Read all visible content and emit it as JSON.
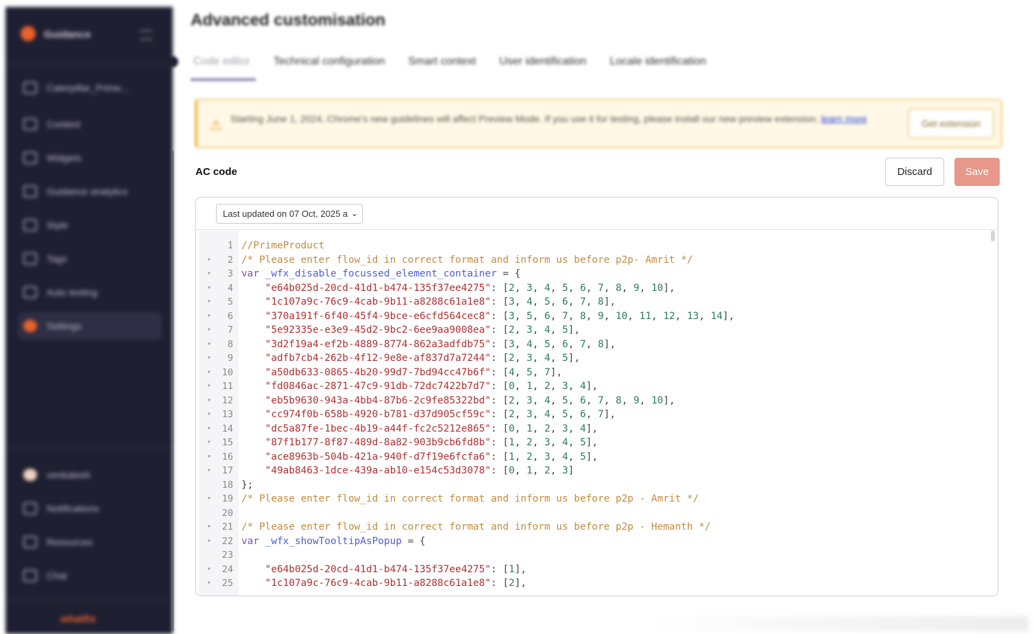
{
  "sidebar": {
    "brand": "Guidance",
    "items": [
      {
        "label": "Caterpillar_Prime...",
        "icon": "home-icon"
      },
      {
        "label": "Content",
        "icon": "grid-icon"
      },
      {
        "label": "Widgets",
        "icon": "calendar-icon"
      },
      {
        "label": "Guidance analytics",
        "icon": "analytics-icon"
      },
      {
        "label": "Style",
        "icon": "style-icon"
      },
      {
        "label": "Tags",
        "icon": "tag-icon"
      },
      {
        "label": "Auto testing",
        "icon": "test-icon"
      },
      {
        "label": "Settings",
        "icon": "settings-icon"
      }
    ],
    "footer_items": [
      {
        "label": "venkatesh",
        "icon": "avatar"
      },
      {
        "label": "Notifications",
        "icon": "bell-icon"
      },
      {
        "label": "Resources",
        "icon": "book-icon"
      },
      {
        "label": "Chat",
        "icon": "chat-icon"
      }
    ],
    "footer_logo": "whatfix",
    "accent": "#e8622c"
  },
  "header": {
    "title": "Advanced customisation",
    "tabs": [
      {
        "label": "Code editor",
        "active": true
      },
      {
        "label": "Technical configuration"
      },
      {
        "label": "Smart context"
      },
      {
        "label": "User identification"
      },
      {
        "label": "Locale identification"
      }
    ]
  },
  "banner": {
    "message": "Starting June 1, 2024, Chrome's new guidelines will affect Preview Mode. If you use it for testing, please install our new preview extension.",
    "link": "learn more",
    "button": "Get extension"
  },
  "panel": {
    "label": "AC code",
    "discard": "Discard",
    "save": "Save",
    "version": "Last updated on 07 Oct, 2025 a",
    "save_color": "#e79888"
  },
  "code": {
    "lines": [
      {
        "n": "1",
        "fold": false,
        "segs": [
          [
            "cm",
            "//PrimeProduct"
          ]
        ]
      },
      {
        "n": "2",
        "fold": true,
        "segs": [
          [
            "cm",
            "/* Please enter flow_id in correct format and inform us before p2p- Amrit */"
          ]
        ]
      },
      {
        "n": "3",
        "fold": true,
        "segs": [
          [
            "kw",
            "var "
          ],
          [
            "var",
            "_wfx_disable_focussed_element_container"
          ],
          [
            "pun",
            " = {"
          ]
        ]
      },
      {
        "n": "4",
        "fold": true,
        "segs": [
          [
            "pun",
            "    "
          ],
          [
            "str",
            "\"e64b025d-20cd-41d1-b474-135f37ee4275\""
          ],
          [
            "pun",
            ": ["
          ],
          [
            "num",
            "2"
          ],
          [
            "pun",
            ", "
          ],
          [
            "num",
            "3"
          ],
          [
            "pun",
            ", "
          ],
          [
            "num",
            "4"
          ],
          [
            "pun",
            ", "
          ],
          [
            "num",
            "5"
          ],
          [
            "pun",
            ", "
          ],
          [
            "num",
            "6"
          ],
          [
            "pun",
            ", "
          ],
          [
            "num",
            "7"
          ],
          [
            "pun",
            ", "
          ],
          [
            "num",
            "8"
          ],
          [
            "pun",
            ", "
          ],
          [
            "num",
            "9"
          ],
          [
            "pun",
            ", "
          ],
          [
            "num",
            "10"
          ],
          [
            "pun",
            "],"
          ]
        ]
      },
      {
        "n": "5",
        "fold": true,
        "segs": [
          [
            "pun",
            "    "
          ],
          [
            "str",
            "\"1c107a9c-76c9-4cab-9b11-a8288c61a1e8\""
          ],
          [
            "pun",
            ": ["
          ],
          [
            "num",
            "3"
          ],
          [
            "pun",
            ", "
          ],
          [
            "num",
            "4"
          ],
          [
            "pun",
            ", "
          ],
          [
            "num",
            "5"
          ],
          [
            "pun",
            ", "
          ],
          [
            "num",
            "6"
          ],
          [
            "pun",
            ", "
          ],
          [
            "num",
            "7"
          ],
          [
            "pun",
            ", "
          ],
          [
            "num",
            "8"
          ],
          [
            "pun",
            "],"
          ]
        ]
      },
      {
        "n": "6",
        "fold": true,
        "segs": [
          [
            "pun",
            "    "
          ],
          [
            "str",
            "\"370a191f-6f40-45f4-9bce-e6cfd564cec8\""
          ],
          [
            "pun",
            ": ["
          ],
          [
            "num",
            "3"
          ],
          [
            "pun",
            ", "
          ],
          [
            "num",
            "5"
          ],
          [
            "pun",
            ", "
          ],
          [
            "num",
            "6"
          ],
          [
            "pun",
            ", "
          ],
          [
            "num",
            "7"
          ],
          [
            "pun",
            ", "
          ],
          [
            "num",
            "8"
          ],
          [
            "pun",
            ", "
          ],
          [
            "num",
            "9"
          ],
          [
            "pun",
            ", "
          ],
          [
            "num",
            "10"
          ],
          [
            "pun",
            ", "
          ],
          [
            "num",
            "11"
          ],
          [
            "pun",
            ", "
          ],
          [
            "num",
            "12"
          ],
          [
            "pun",
            ", "
          ],
          [
            "num",
            "13"
          ],
          [
            "pun",
            ", "
          ],
          [
            "num",
            "14"
          ],
          [
            "pun",
            "],"
          ]
        ]
      },
      {
        "n": "7",
        "fold": true,
        "segs": [
          [
            "pun",
            "    "
          ],
          [
            "str",
            "\"5e92335e-e3e9-45d2-9bc2-6ee9aa9008ea\""
          ],
          [
            "pun",
            ": ["
          ],
          [
            "num",
            "2"
          ],
          [
            "pun",
            ", "
          ],
          [
            "num",
            "3"
          ],
          [
            "pun",
            ", "
          ],
          [
            "num",
            "4"
          ],
          [
            "pun",
            ", "
          ],
          [
            "num",
            "5"
          ],
          [
            "pun",
            "],"
          ]
        ]
      },
      {
        "n": "8",
        "fold": true,
        "segs": [
          [
            "pun",
            "    "
          ],
          [
            "str",
            "\"3d2f19a4-ef2b-4889-8774-862a3adfdb75\""
          ],
          [
            "pun",
            ": ["
          ],
          [
            "num",
            "3"
          ],
          [
            "pun",
            ", "
          ],
          [
            "num",
            "4"
          ],
          [
            "pun",
            ", "
          ],
          [
            "num",
            "5"
          ],
          [
            "pun",
            ", "
          ],
          [
            "num",
            "6"
          ],
          [
            "pun",
            ", "
          ],
          [
            "num",
            "7"
          ],
          [
            "pun",
            ", "
          ],
          [
            "num",
            "8"
          ],
          [
            "pun",
            "],"
          ]
        ]
      },
      {
        "n": "9",
        "fold": true,
        "segs": [
          [
            "pun",
            "    "
          ],
          [
            "str",
            "\"adfb7cb4-262b-4f12-9e8e-af837d7a7244\""
          ],
          [
            "pun",
            ": ["
          ],
          [
            "num",
            "2"
          ],
          [
            "pun",
            ", "
          ],
          [
            "num",
            "3"
          ],
          [
            "pun",
            ", "
          ],
          [
            "num",
            "4"
          ],
          [
            "pun",
            ", "
          ],
          [
            "num",
            "5"
          ],
          [
            "pun",
            "],"
          ]
        ]
      },
      {
        "n": "10",
        "fold": true,
        "segs": [
          [
            "pun",
            "    "
          ],
          [
            "str",
            "\"a50db633-0865-4b20-99d7-7bd94cc47b6f\""
          ],
          [
            "pun",
            ": ["
          ],
          [
            "num",
            "4"
          ],
          [
            "pun",
            ", "
          ],
          [
            "num",
            "5"
          ],
          [
            "pun",
            ", "
          ],
          [
            "num",
            "7"
          ],
          [
            "pun",
            "],"
          ]
        ]
      },
      {
        "n": "11",
        "fold": true,
        "segs": [
          [
            "pun",
            "    "
          ],
          [
            "str",
            "\"fd0846ac-2871-47c9-91db-72dc7422b7d7\""
          ],
          [
            "pun",
            ": ["
          ],
          [
            "num",
            "0"
          ],
          [
            "pun",
            ", "
          ],
          [
            "num",
            "1"
          ],
          [
            "pun",
            ", "
          ],
          [
            "num",
            "2"
          ],
          [
            "pun",
            ", "
          ],
          [
            "num",
            "3"
          ],
          [
            "pun",
            ", "
          ],
          [
            "num",
            "4"
          ],
          [
            "pun",
            "],"
          ]
        ]
      },
      {
        "n": "12",
        "fold": true,
        "segs": [
          [
            "pun",
            "    "
          ],
          [
            "str",
            "\"eb5b9630-943a-4bb4-87b6-2c9fe85322bd\""
          ],
          [
            "pun",
            ": ["
          ],
          [
            "num",
            "2"
          ],
          [
            "pun",
            ", "
          ],
          [
            "num",
            "3"
          ],
          [
            "pun",
            ", "
          ],
          [
            "num",
            "4"
          ],
          [
            "pun",
            ", "
          ],
          [
            "num",
            "5"
          ],
          [
            "pun",
            ", "
          ],
          [
            "num",
            "6"
          ],
          [
            "pun",
            ", "
          ],
          [
            "num",
            "7"
          ],
          [
            "pun",
            ", "
          ],
          [
            "num",
            "8"
          ],
          [
            "pun",
            ", "
          ],
          [
            "num",
            "9"
          ],
          [
            "pun",
            ", "
          ],
          [
            "num",
            "10"
          ],
          [
            "pun",
            "],"
          ]
        ]
      },
      {
        "n": "13",
        "fold": true,
        "segs": [
          [
            "pun",
            "    "
          ],
          [
            "str",
            "\"cc974f0b-658b-4920-b781-d37d905cf59c\""
          ],
          [
            "pun",
            ": ["
          ],
          [
            "num",
            "2"
          ],
          [
            "pun",
            ", "
          ],
          [
            "num",
            "3"
          ],
          [
            "pun",
            ", "
          ],
          [
            "num",
            "4"
          ],
          [
            "pun",
            ", "
          ],
          [
            "num",
            "5"
          ],
          [
            "pun",
            ", "
          ],
          [
            "num",
            "6"
          ],
          [
            "pun",
            ", "
          ],
          [
            "num",
            "7"
          ],
          [
            "pun",
            "],"
          ]
        ]
      },
      {
        "n": "14",
        "fold": true,
        "segs": [
          [
            "pun",
            "    "
          ],
          [
            "str",
            "\"dc5a87fe-1bec-4b19-a44f-fc2c5212e865\""
          ],
          [
            "pun",
            ": ["
          ],
          [
            "num",
            "0"
          ],
          [
            "pun",
            ", "
          ],
          [
            "num",
            "1"
          ],
          [
            "pun",
            ", "
          ],
          [
            "num",
            "2"
          ],
          [
            "pun",
            ", "
          ],
          [
            "num",
            "3"
          ],
          [
            "pun",
            ", "
          ],
          [
            "num",
            "4"
          ],
          [
            "pun",
            "],"
          ]
        ]
      },
      {
        "n": "15",
        "fold": true,
        "segs": [
          [
            "pun",
            "    "
          ],
          [
            "str",
            "\"87f1b177-8f87-489d-8a82-903b9cb6fd8b\""
          ],
          [
            "pun",
            ": ["
          ],
          [
            "num",
            "1"
          ],
          [
            "pun",
            ", "
          ],
          [
            "num",
            "2"
          ],
          [
            "pun",
            ", "
          ],
          [
            "num",
            "3"
          ],
          [
            "pun",
            ", "
          ],
          [
            "num",
            "4"
          ],
          [
            "pun",
            ", "
          ],
          [
            "num",
            "5"
          ],
          [
            "pun",
            "],"
          ]
        ]
      },
      {
        "n": "16",
        "fold": true,
        "segs": [
          [
            "pun",
            "    "
          ],
          [
            "str",
            "\"ace8963b-504b-421a-940f-d7f19e6fcfa6\""
          ],
          [
            "pun",
            ": ["
          ],
          [
            "num",
            "1"
          ],
          [
            "pun",
            ", "
          ],
          [
            "num",
            "2"
          ],
          [
            "pun",
            ", "
          ],
          [
            "num",
            "3"
          ],
          [
            "pun",
            ", "
          ],
          [
            "num",
            "4"
          ],
          [
            "pun",
            ", "
          ],
          [
            "num",
            "5"
          ],
          [
            "pun",
            "],"
          ]
        ]
      },
      {
        "n": "17",
        "fold": true,
        "segs": [
          [
            "pun",
            "    "
          ],
          [
            "str",
            "\"49ab8463-1dce-439a-ab10-e154c53d3078\""
          ],
          [
            "pun",
            ": ["
          ],
          [
            "num",
            "0"
          ],
          [
            "pun",
            ", "
          ],
          [
            "num",
            "1"
          ],
          [
            "pun",
            ", "
          ],
          [
            "num",
            "2"
          ],
          [
            "pun",
            ", "
          ],
          [
            "num",
            "3"
          ],
          [
            "pun",
            "]"
          ]
        ]
      },
      {
        "n": "18",
        "fold": false,
        "segs": [
          [
            "pun",
            "};"
          ]
        ]
      },
      {
        "n": "19",
        "fold": true,
        "segs": [
          [
            "cm",
            "/* Please enter flow_id in correct format and inform us before p2p - Amrit */"
          ]
        ]
      },
      {
        "n": "20",
        "fold": false,
        "segs": [
          [
            "pun",
            ""
          ]
        ]
      },
      {
        "n": "21",
        "fold": true,
        "segs": [
          [
            "cm",
            "/* Please enter flow_id in correct format and inform us before p2p - Hemanth */"
          ]
        ]
      },
      {
        "n": "22",
        "fold": true,
        "segs": [
          [
            "kw",
            "var "
          ],
          [
            "var",
            "_wfx_showTooltipAsPopup"
          ],
          [
            "pun",
            " = {"
          ]
        ]
      },
      {
        "n": "23",
        "fold": false,
        "segs": [
          [
            "pun",
            ""
          ]
        ]
      },
      {
        "n": "24",
        "fold": true,
        "segs": [
          [
            "pun",
            "    "
          ],
          [
            "str",
            "\"e64b025d-20cd-41d1-b474-135f37ee4275\""
          ],
          [
            "pun",
            ": ["
          ],
          [
            "num",
            "1"
          ],
          [
            "pun",
            "],"
          ]
        ]
      },
      {
        "n": "25",
        "fold": true,
        "segs": [
          [
            "pun",
            "    "
          ],
          [
            "str",
            "\"1c107a9c-76c9-4cab-9b11-a8288c61a1e8\""
          ],
          [
            "pun",
            ": ["
          ],
          [
            "num",
            "2"
          ],
          [
            "pun",
            "],"
          ]
        ]
      }
    ]
  }
}
